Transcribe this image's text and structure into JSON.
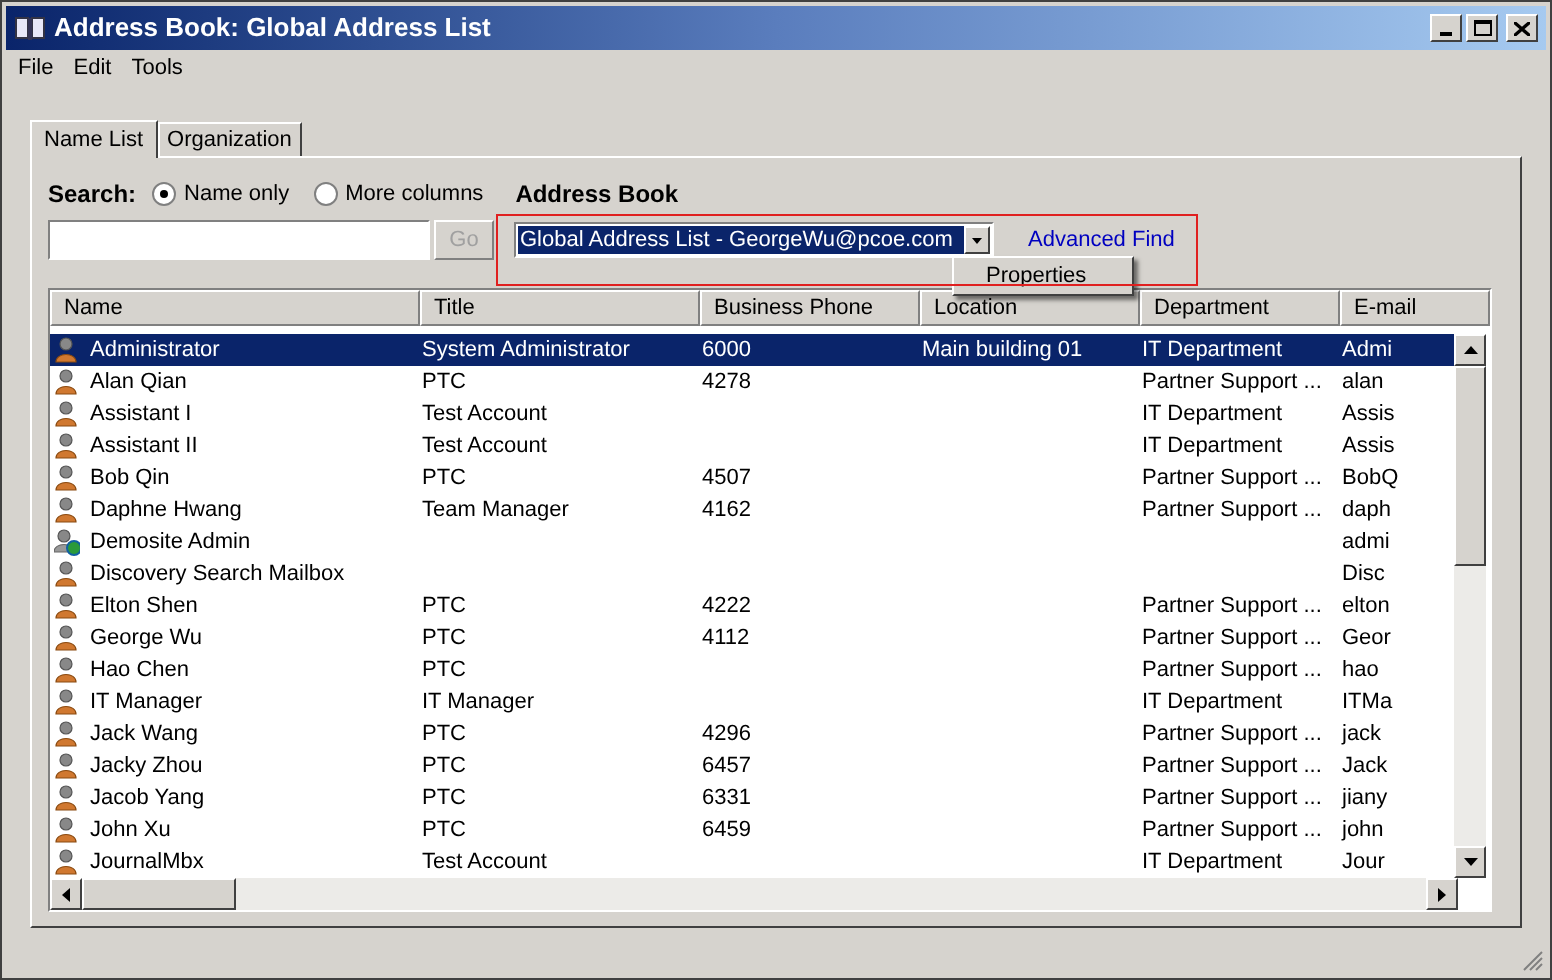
{
  "window": {
    "title": "Address Book: Global Address List"
  },
  "menu": [
    "File",
    "Edit",
    "Tools"
  ],
  "tabs": [
    {
      "label": "Name List",
      "selected": true
    },
    {
      "label": "Organization",
      "selected": false
    }
  ],
  "search": {
    "label": "Search:",
    "options": [
      {
        "label": "Name only",
        "selected": true
      },
      {
        "label": "More columns",
        "selected": false
      }
    ],
    "go": "Go"
  },
  "address_book": {
    "label": "Address Book",
    "value": "Global Address List - GeorgeWu@pcoe.com",
    "advanced": "Advanced Find"
  },
  "context_menu": [
    "Properties"
  ],
  "table": {
    "columns": [
      "Name",
      "Title",
      "Business Phone",
      "Location",
      "Department",
      "E-mail"
    ],
    "rows": [
      {
        "kind": "user",
        "selected": true,
        "cells": [
          "Administrator",
          "System Administrator",
          "6000",
          "Main building 01",
          "IT Department",
          "Admi"
        ]
      },
      {
        "kind": "user",
        "selected": false,
        "cells": [
          "Alan Qian",
          "PTC",
          "4278",
          "",
          "Partner Support ...",
          "alan"
        ]
      },
      {
        "kind": "user",
        "selected": false,
        "cells": [
          "Assistant I",
          "Test Account",
          "",
          "",
          "IT Department",
          "Assis"
        ]
      },
      {
        "kind": "user",
        "selected": false,
        "cells": [
          "Assistant II",
          "Test Account",
          "",
          "",
          "IT Department",
          "Assis"
        ]
      },
      {
        "kind": "user",
        "selected": false,
        "cells": [
          "Bob Qin",
          "PTC",
          "4507",
          "",
          "Partner Support ...",
          "BobQ"
        ]
      },
      {
        "kind": "user",
        "selected": false,
        "cells": [
          "Daphne Hwang",
          "Team Manager",
          "4162",
          "",
          "Partner Support ...",
          "daph"
        ]
      },
      {
        "kind": "external",
        "selected": false,
        "cells": [
          "Demosite Admin",
          "",
          "",
          "",
          "",
          "admi"
        ]
      },
      {
        "kind": "user",
        "selected": false,
        "cells": [
          "Discovery Search Mailbox",
          "",
          "",
          "",
          "",
          "Disc"
        ]
      },
      {
        "kind": "user",
        "selected": false,
        "cells": [
          "Elton Shen",
          "PTC",
          "4222",
          "",
          "Partner Support ...",
          "elton"
        ]
      },
      {
        "kind": "user",
        "selected": false,
        "cells": [
          "George Wu",
          "PTC",
          "4112",
          "",
          "Partner Support ...",
          "Geor"
        ]
      },
      {
        "kind": "user",
        "selected": false,
        "cells": [
          "Hao Chen",
          "PTC",
          "",
          "",
          "Partner Support ...",
          "hao"
        ]
      },
      {
        "kind": "user",
        "selected": false,
        "cells": [
          "IT Manager",
          "IT Manager",
          "",
          "",
          "IT Department",
          "ITMa"
        ]
      },
      {
        "kind": "user",
        "selected": false,
        "cells": [
          "Jack Wang",
          "PTC",
          "4296",
          "",
          "Partner Support ...",
          "jack"
        ]
      },
      {
        "kind": "user",
        "selected": false,
        "cells": [
          "Jacky Zhou",
          "PTC",
          "6457",
          "",
          "Partner Support ...",
          "Jack"
        ]
      },
      {
        "kind": "user",
        "selected": false,
        "cells": [
          "Jacob Yang",
          "PTC",
          "6331",
          "",
          "Partner Support ...",
          "jiany"
        ]
      },
      {
        "kind": "user",
        "selected": false,
        "cells": [
          "John Xu",
          "PTC",
          "6459",
          "",
          "Partner Support ...",
          "john"
        ]
      },
      {
        "kind": "user",
        "selected": false,
        "cells": [
          "JournalMbx",
          "Test Account",
          "",
          "",
          "IT Department",
          "Jour"
        ]
      }
    ]
  }
}
